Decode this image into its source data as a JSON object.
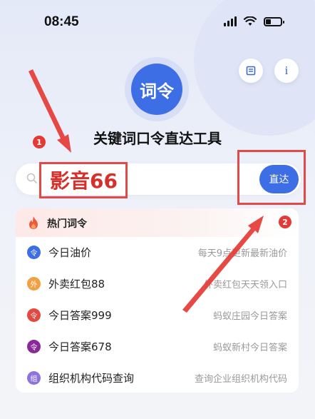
{
  "status": {
    "time": "08:45"
  },
  "header": {
    "logo_text": "词令",
    "title": "关键词口令直达工具"
  },
  "search": {
    "value": "影音66",
    "go_label": "直达"
  },
  "annotations": {
    "badge1": "1",
    "badge2": "2"
  },
  "hot": {
    "title": "热门词令",
    "items": [
      {
        "title": "今日油价",
        "desc": "每天9点更新最新油价",
        "icon_char": "令",
        "color": "#3d6ee6"
      },
      {
        "title": "外卖红包88",
        "desc": "外卖红包天天领入口",
        "icon_char": "外",
        "color": "#f2a044"
      },
      {
        "title": "今日答案999",
        "desc": "蚂蚁庄园今日答案",
        "icon_char": "令",
        "color": "#e5483e"
      },
      {
        "title": "今日答案678",
        "desc": "蚂蚁新村今日答案",
        "icon_char": "令",
        "color": "#8a2a9a"
      },
      {
        "title": "组织机构代码查询",
        "desc": "查询企业组织机构代码",
        "icon_char": "组",
        "color": "#8e73e0"
      }
    ]
  },
  "colors": {
    "primary": "#3d6ee6",
    "annotation_red": "#e24a48"
  }
}
